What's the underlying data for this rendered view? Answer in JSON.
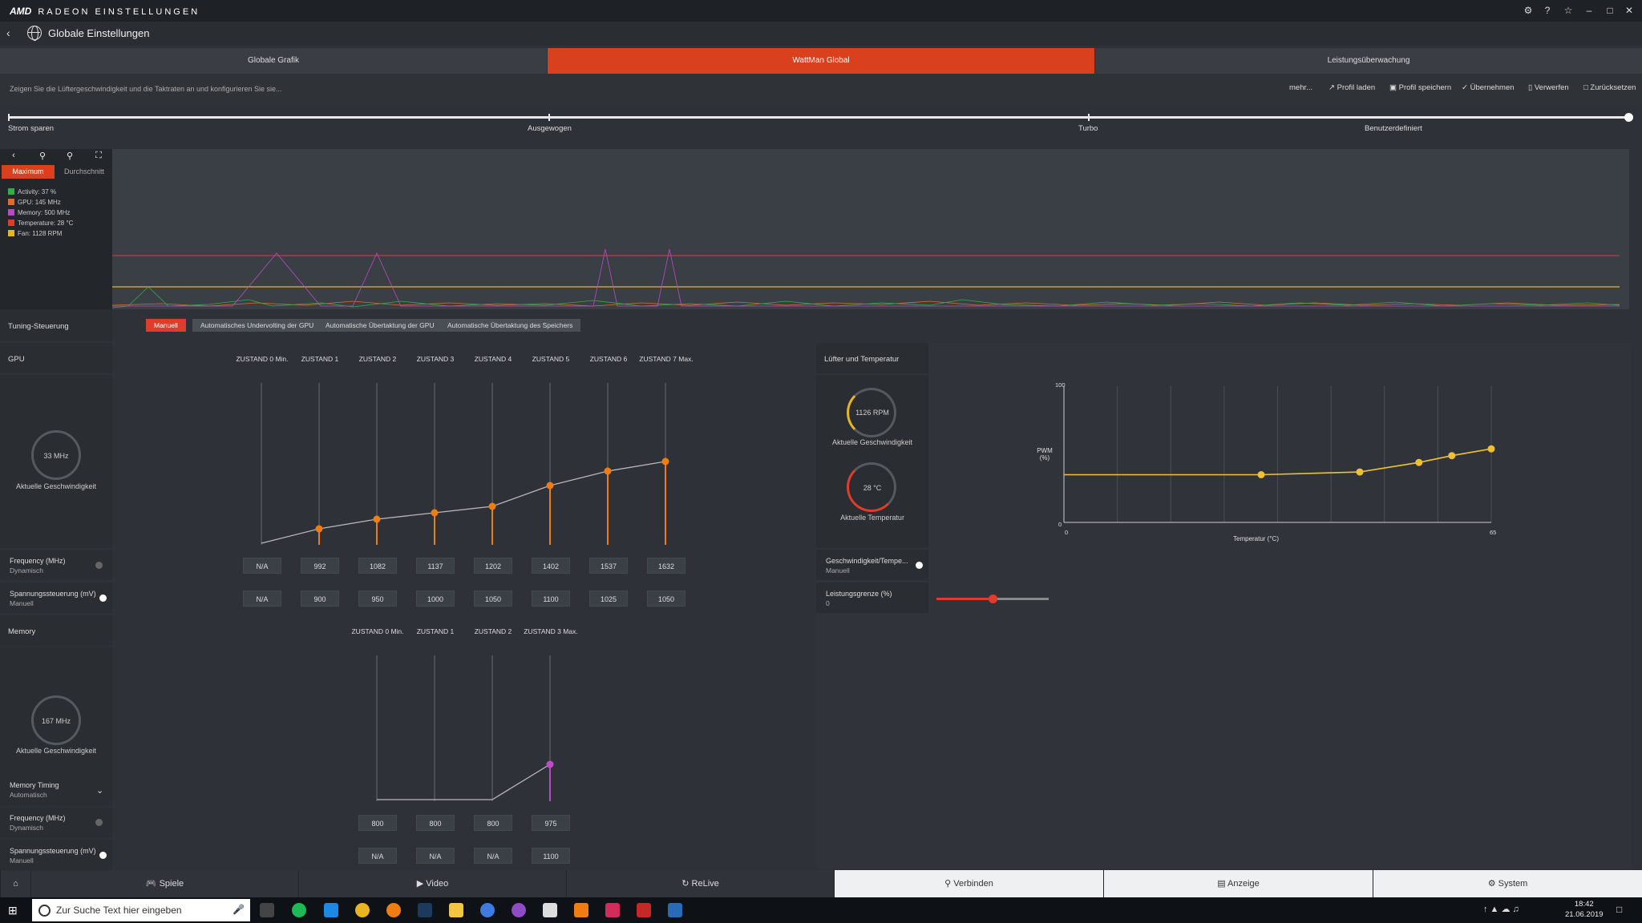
{
  "app": {
    "brand": "AMD",
    "title": "RADEON EINSTELLUNGEN",
    "page_title": "Globale Einstellungen"
  },
  "tabs": [
    {
      "label": "Globale Grafik"
    },
    {
      "label": "WattMan Global"
    },
    {
      "label": "Leistungsüberwachung"
    }
  ],
  "info_text": "Zeigen Sie die Lüftergeschwindigkeit und die Taktraten an und konfigurieren Sie sie...",
  "actions": {
    "more": "mehr...",
    "load": "Profil laden",
    "save": "Profil speichern",
    "apply": "Übernehmen",
    "discard": "Verwerfen",
    "reset": "Zurücksetzen"
  },
  "presets": [
    "Strom sparen",
    "Ausgewogen",
    "Turbo",
    "Benutzerdefiniert"
  ],
  "graph": {
    "tab_max": "Maximum",
    "tab_avg": "Durchschnitt",
    "legend": [
      {
        "text": "Activity: 37 %",
        "color": "#2fae4a"
      },
      {
        "text": "GPU: 145 MHz",
        "color": "#e26a2c"
      },
      {
        "text": "Memory: 500 MHz",
        "color": "#b84bc4"
      },
      {
        "text": "Temperature: 28 °C",
        "color": "#e03c2c"
      },
      {
        "text": "Fan: 1128 RPM",
        "color": "#e8b521"
      }
    ]
  },
  "tuning": {
    "label": "Tuning-Steuerung",
    "modes": [
      "Manuell",
      "Automatisches Undervolting der GPU",
      "Automatische Übertaktung der GPU",
      "Automatische Übertaktung des Speichers"
    ]
  },
  "gpu": {
    "label": "GPU",
    "states": [
      "ZUSTAND 0 Min.",
      "ZUSTAND 1",
      "ZUSTAND 2",
      "ZUSTAND 3",
      "ZUSTAND 4",
      "ZUSTAND 5",
      "ZUSTAND 6",
      "ZUSTAND 7 Max."
    ],
    "gauge_value": "33 MHz",
    "gauge_label": "Aktuelle Geschwindigkeit",
    "frequency_label": "Frequency (MHz)",
    "frequency_mode": "Dynamisch",
    "frequency": [
      "N/A",
      "992",
      "1082",
      "1137",
      "1202",
      "1402",
      "1537",
      "1632"
    ],
    "voltage_label": "Spannungssteuerung (mV)",
    "voltage_mode": "Manuell",
    "voltage": [
      "N/A",
      "900",
      "950",
      "1000",
      "1050",
      "1100",
      "1025",
      "1050"
    ]
  },
  "memory": {
    "label": "Memory",
    "states": [
      "ZUSTAND 0 Min.",
      "ZUSTAND 1",
      "ZUSTAND 2",
      "ZUSTAND 3 Max."
    ],
    "gauge_value": "167 MHz",
    "gauge_label": "Aktuelle Geschwindigkeit",
    "timing_label": "Memory Timing",
    "timing_mode": "Automatisch",
    "frequency_label": "Frequency (MHz)",
    "frequency_mode": "Dynamisch",
    "frequency": [
      "800",
      "800",
      "800",
      "975"
    ],
    "voltage_label": "Spannungssteuerung (mV)",
    "voltage_mode": "Manuell",
    "voltage": [
      "N/A",
      "N/A",
      "N/A",
      "1100"
    ]
  },
  "fan": {
    "label": "Lüfter und Temperatur",
    "rpm": "1126 RPM",
    "rpm_label": "Aktuelle Geschwindigkeit",
    "temp": "28 °C",
    "temp_label": "Aktuelle Temperatur",
    "speed_temp_label": "Geschwindigkeit/Tempe...",
    "speed_temp_mode": "Manuell",
    "power_label": "Leistungsgrenze (%)",
    "power_value": "0",
    "power_fraction": 0.5,
    "chart": {
      "ylabel": "PWM\n(%)",
      "y_max": "100",
      "y_min": "0",
      "x_min": "0",
      "x_max": "65",
      "xlabel": "Temperatur (°C)"
    }
  },
  "chart_data": {
    "type": "line",
    "xlabel": "Temperatur (°C)",
    "ylabel": "PWM (%)",
    "xlim": [
      0,
      65
    ],
    "ylim": [
      0,
      100
    ],
    "x": [
      0,
      30,
      45,
      54,
      59,
      65
    ],
    "series": [
      {
        "values": [
          35,
          35,
          37,
          44,
          49,
          54
        ],
        "color": "#f0c030"
      }
    ]
  },
  "bottom_nav": [
    "Spiele",
    "Video",
    "ReLive",
    "Verbinden",
    "Anzeige",
    "System"
  ],
  "taskbar": {
    "search_placeholder": "Zur Suche Text hier eingeben",
    "time": "18:42",
    "date": "21.06.2019"
  }
}
